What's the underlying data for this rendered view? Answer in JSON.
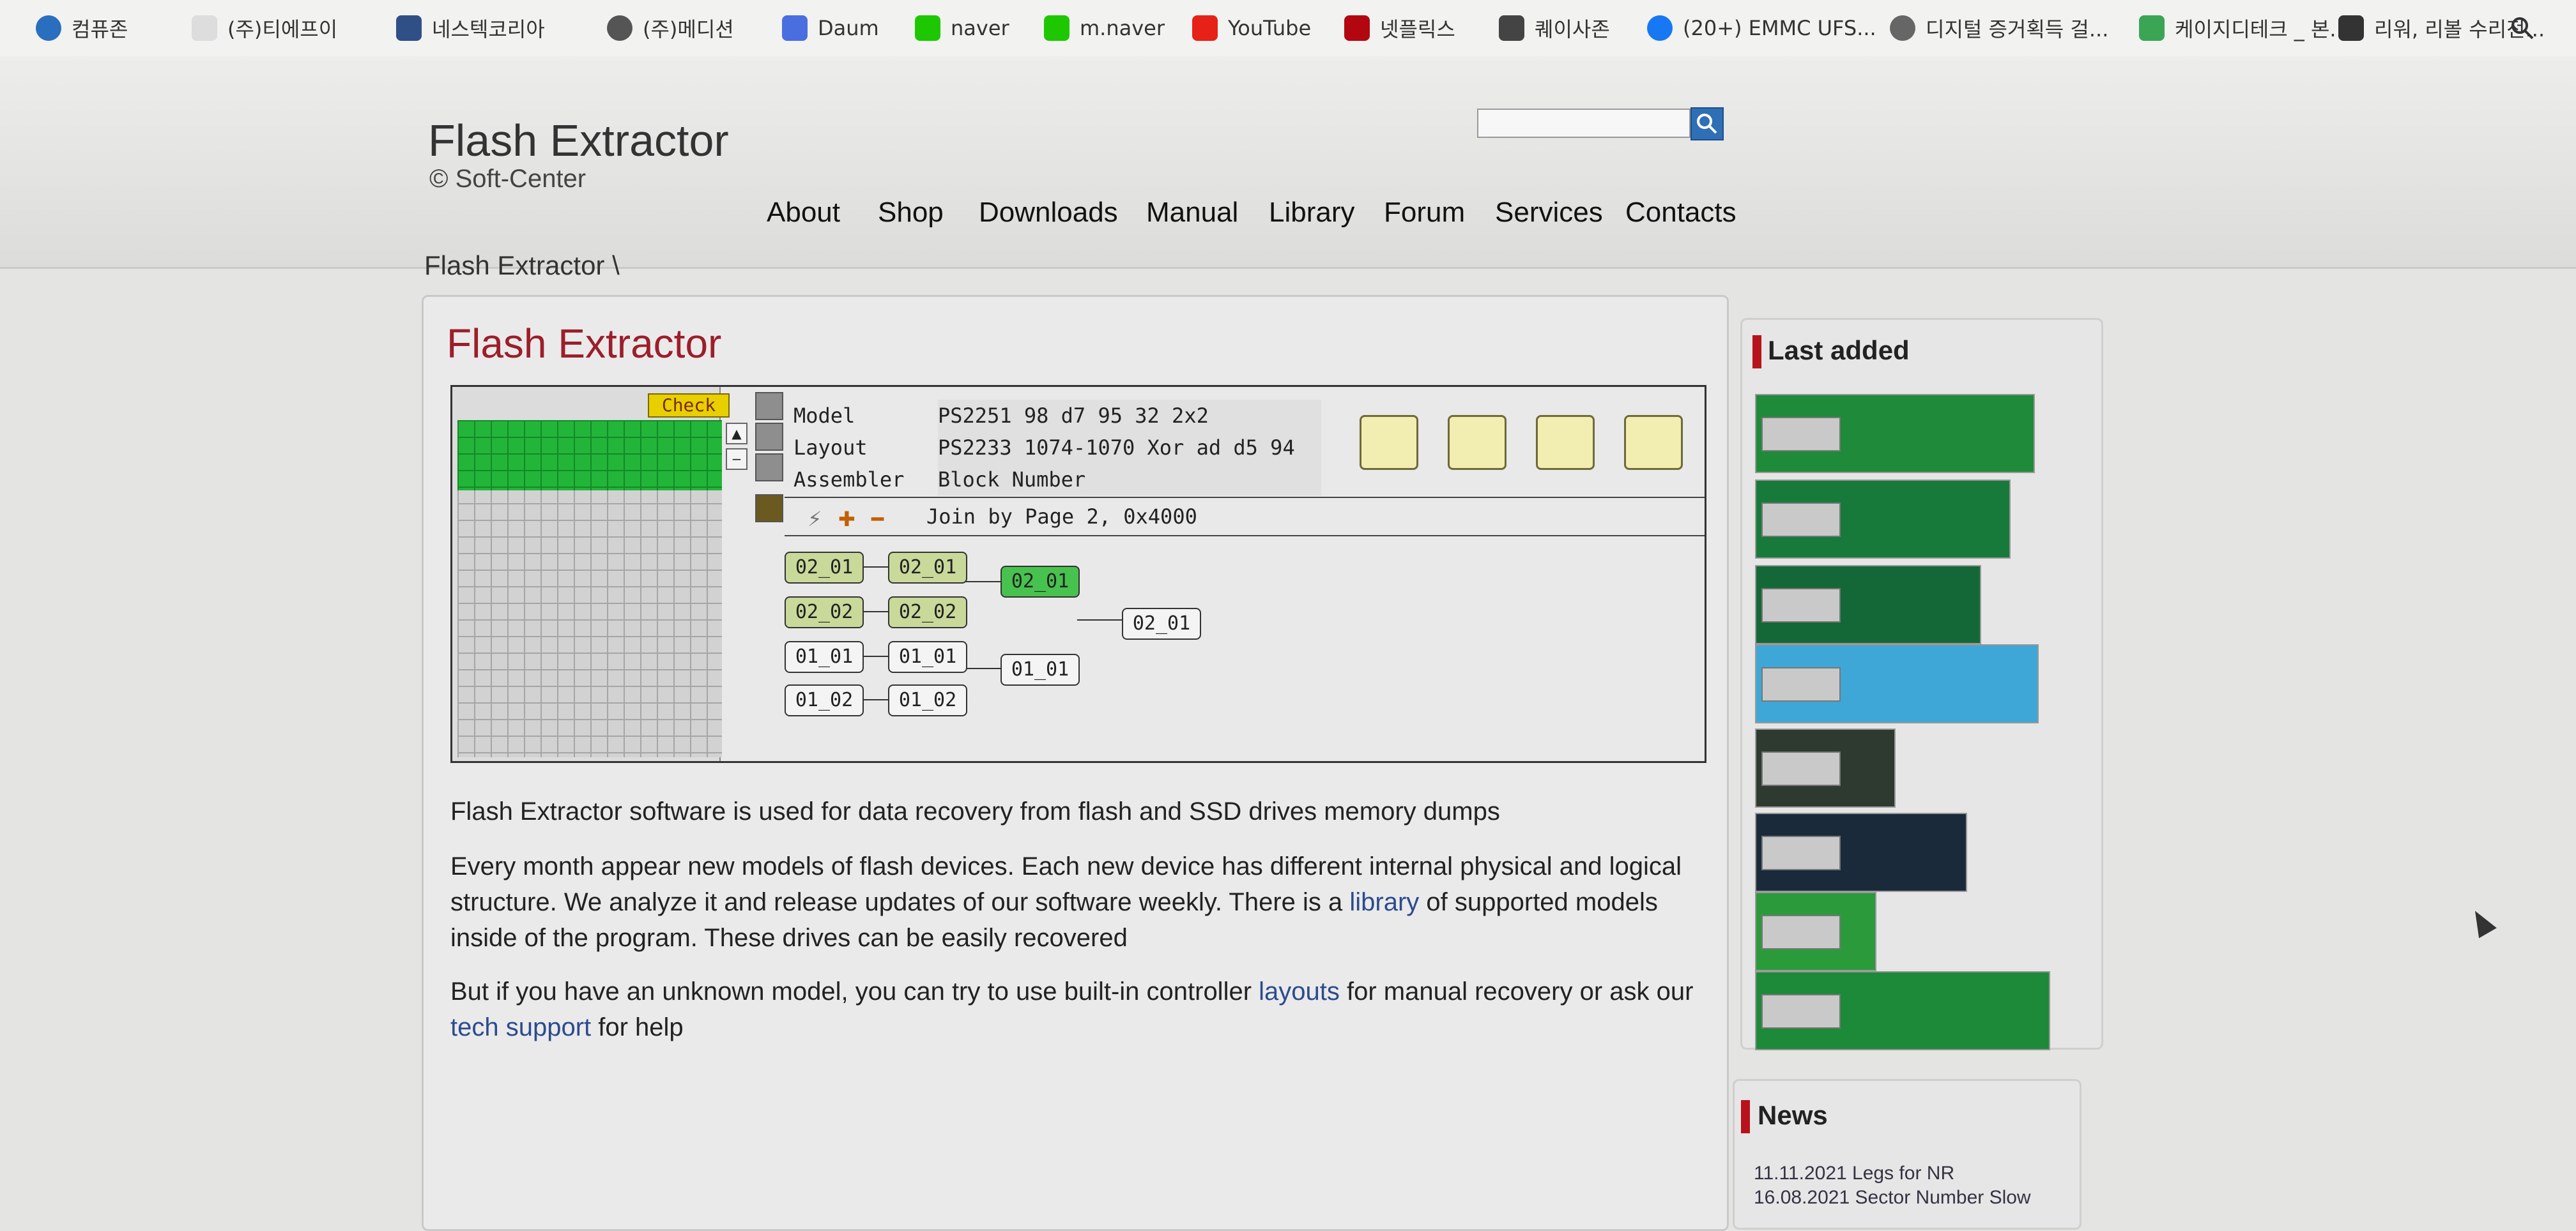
{
  "bookmarks": [
    {
      "label": "컴퓨존",
      "color": "#2a6ebf"
    },
    {
      "label": "(주)티에프이",
      "color": "#dddddd"
    },
    {
      "label": "네스텍코리아",
      "color": "#2f4f86"
    },
    {
      "label": "(주)메디션",
      "color": "#555555"
    },
    {
      "label": "Daum",
      "color": "#4a6ee0"
    },
    {
      "label": "naver",
      "color": "#1ec800"
    },
    {
      "label": "m.naver",
      "color": "#1ec800"
    },
    {
      "label": "YouTube",
      "color": "#e62117"
    },
    {
      "label": "넷플릭스",
      "color": "#b20710"
    },
    {
      "label": "퀘이사존",
      "color": "#444444"
    },
    {
      "label": "(20+) EMMC UFS...",
      "color": "#1877f2"
    },
    {
      "label": "디지털 증거획득 걸...",
      "color": "#666666"
    },
    {
      "label": "케이지디테크 _ 본...",
      "color": "#3aa655"
    },
    {
      "label": "리워, 리볼 수리전...",
      "color": "#333333"
    }
  ],
  "header": {
    "title": "Flash Extractor",
    "subtitle": "© Soft-Center",
    "nav": [
      "About",
      "Shop",
      "Downloads",
      "Manual",
      "Library",
      "Forum",
      "Services",
      "Contacts"
    ]
  },
  "breadcrumb": "Flash Extractor \\",
  "main": {
    "title": "Flash Extractor",
    "app": {
      "check_label": "Check",
      "model_key": "Model",
      "model_val": "PS2251   98 d7 95 32   2x2",
      "layout_key": "Layout",
      "layout_val": "PS2233 1074-1070 Xor ad d5 94",
      "assembler_key": "Assembler",
      "assembler_val": "Block Number",
      "join_text": "Join by Page 2, 0x4000",
      "nodes": {
        "a1": "02_01",
        "a2": "02_01",
        "a3": "02_01",
        "b1": "02_02",
        "b2": "02_02",
        "c1": "01_01",
        "c2": "01_01",
        "c3": "01_01",
        "d1": "01_02",
        "d2": "01_02",
        "root": "02_01"
      }
    },
    "para1": "Flash Extractor software is used for data recovery from flash and SSD drives memory dumps",
    "para2_a": "Every month appear new models of flash devices. Each new device has different internal physical and logical structure. We analyze it and release updates of our software weekly. There is a ",
    "para2_link": "library",
    "para2_b": " of supported models inside of the program. These drives can be easily recovered",
    "para3_a": "But if you have an unknown model, you can try to use built-in controller ",
    "para3_link1": "layouts",
    "para3_b": " for manual recovery or ask our ",
    "para3_link2": "tech support",
    "para3_c": " for help"
  },
  "sidebar": {
    "last_added": "Last added",
    "news": "News",
    "news_items": [
      {
        "date": "11.11.2021",
        "text": "Legs for NR"
      },
      {
        "date": "16.08.2021",
        "text": "Sector Number Slow"
      }
    ]
  },
  "colors": {
    "accent": "#9b1e2a",
    "link": "#2c4a8e",
    "search": "#2e6fb5"
  }
}
